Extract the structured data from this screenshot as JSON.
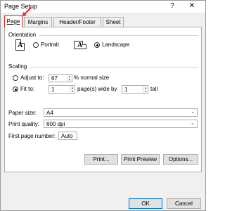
{
  "window": {
    "title": "Page Setup",
    "help_label": "?",
    "close_label": "✕"
  },
  "tabs": [
    {
      "label": "Page",
      "active": true
    },
    {
      "label": "Margins",
      "active": false
    },
    {
      "label": "Header/Footer",
      "active": false
    },
    {
      "label": "Sheet",
      "active": false
    }
  ],
  "orientation": {
    "heading": "Orientation",
    "portrait_label": "Portrait",
    "landscape_label": "Landscape",
    "selected": "landscape",
    "icon_letter": "A"
  },
  "scaling": {
    "heading": "Scaling",
    "adjust_to_label": "Adjust to:",
    "adjust_value": "67",
    "percent_label": "% normal size",
    "fit_to_label": "Fit to:",
    "fit_wide_value": "1",
    "pages_wide_label": "page(s) wide by",
    "fit_tall_value": "1",
    "tall_label": "tall",
    "selected": "fit_to"
  },
  "paper_size": {
    "label": "Paper size:",
    "value": "A4"
  },
  "print_quality": {
    "label": "Print quality:",
    "value": "600 dpi"
  },
  "first_page_number": {
    "label": "First page number:",
    "value": "Auto"
  },
  "buttons": {
    "print": "Print...",
    "print_preview": "Print Preview",
    "options": "Options...",
    "ok": "OK",
    "cancel": "Cancel"
  },
  "colors": {
    "tab_highlight": "#e8231f",
    "default_button_border": "#0078d7"
  }
}
